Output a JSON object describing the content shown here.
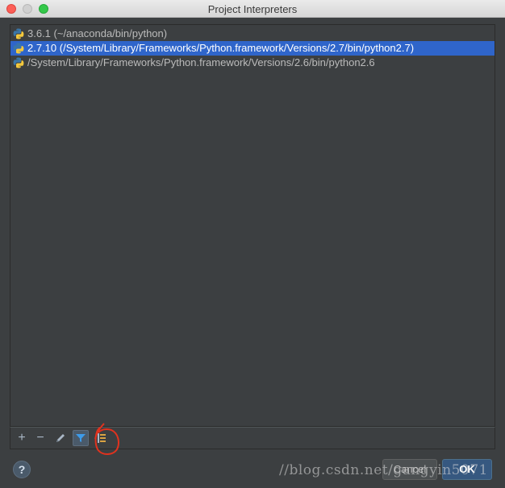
{
  "window": {
    "title": "Project Interpreters"
  },
  "interpreters": [
    {
      "label": "3.6.1 (~/anaconda/bin/python)",
      "selected": false,
      "icon": "python-icon"
    },
    {
      "label": "2.7.10 (/System/Library/Frameworks/Python.framework/Versions/2.7/bin/python2.7)",
      "selected": true,
      "icon": "python-icon"
    },
    {
      "label": "/System/Library/Frameworks/Python.framework/Versions/2.6/bin/python2.6",
      "selected": false,
      "icon": "python-icon"
    }
  ],
  "toolbar": {
    "add_label": "+",
    "remove_label": "−",
    "edit_icon": "pencil-icon",
    "filter_icon": "filter-icon",
    "tree_icon": "show-paths-icon"
  },
  "footer": {
    "help_label": "?",
    "cancel_label": "Cancel",
    "ok_label": "OK",
    "watermark": "//blog.csdn.net/gangyin5071"
  },
  "colors": {
    "selection": "#2f65ca",
    "panel_bg": "#3c3f41",
    "annotation": "#e0321e"
  }
}
